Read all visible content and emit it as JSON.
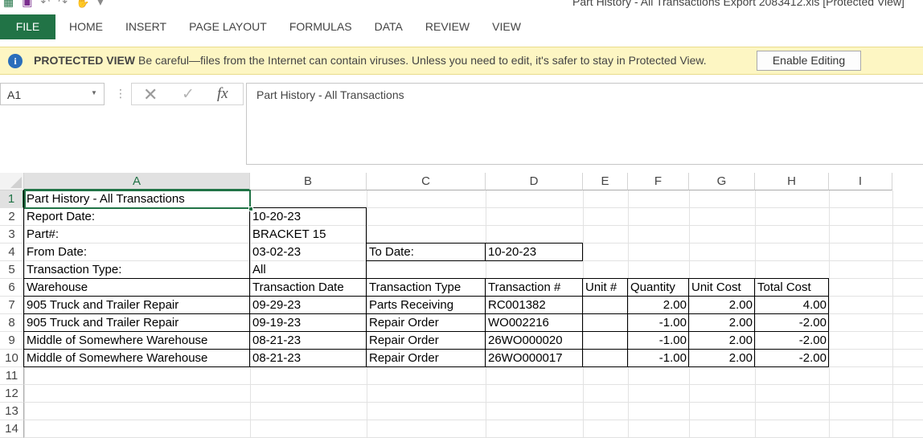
{
  "window": {
    "title": "Part History - All Transactions Export 2083412.xls  [Protected View]"
  },
  "quick_access": {
    "icons": [
      "excel-logo-icon",
      "save-icon",
      "undo-icon",
      "redo-icon",
      "touch-mode-icon",
      "customize-toolbar-icon"
    ]
  },
  "ribbon": {
    "tabs": [
      "FILE",
      "HOME",
      "INSERT",
      "PAGE LAYOUT",
      "FORMULAS",
      "DATA",
      "REVIEW",
      "VIEW"
    ]
  },
  "protected_view": {
    "heading": "PROTECTED VIEW",
    "message": "Be careful—files from the Internet can contain viruses. Unless you need to edit, it's safer to stay in Protected View.",
    "button": "Enable Editing",
    "icon": "i"
  },
  "formula_bar": {
    "name_box": "A1",
    "fx_label": "fx",
    "content": "Part History - All Transactions"
  },
  "sheet": {
    "columns": [
      "A",
      "B",
      "C",
      "D",
      "E",
      "F",
      "G",
      "H",
      "I"
    ],
    "rows": [
      "1",
      "2",
      "3",
      "4",
      "5",
      "6",
      "7",
      "8",
      "9",
      "10",
      "11",
      "12",
      "13",
      "14"
    ],
    "cells": {
      "A1": "Part History - All Transactions",
      "A2": "Report Date:",
      "B2": "10-20-23",
      "A3": "Part#:",
      "B3": "BRACKET 15",
      "A4": "From Date:",
      "B4": "03-02-23",
      "C4": "To Date:",
      "D4": "10-20-23",
      "A5": "Transaction Type:",
      "B5": "All",
      "A6": "Warehouse",
      "B6": "Transaction Date",
      "C6": "Transaction Type",
      "D6": "Transaction #",
      "E6": "Unit #",
      "F6": "Quantity",
      "G6": "Unit Cost",
      "H6": "Total Cost",
      "A7": "905 Truck and Trailer Repair",
      "B7": "09-29-23",
      "C7": "Parts Receiving",
      "D7": "RC001382",
      "F7": "2.00",
      "G7": "2.00",
      "H7": "4.00",
      "A8": "905 Truck and Trailer Repair",
      "B8": "09-19-23",
      "C8": "Repair Order",
      "D8": "WO002216",
      "F8": "-1.00",
      "G8": "2.00",
      "H8": "-2.00",
      "A9": "Middle of Somewhere Warehouse",
      "B9": "08-21-23",
      "C9": "Repair Order",
      "D9": "26WO000020",
      "F9": "-1.00",
      "G9": "2.00",
      "H9": "-2.00",
      "A10": "Middle of Somewhere Warehouse",
      "B10": "08-21-23",
      "C10": "Repair Order",
      "D10": "26WO000017",
      "F10": "-1.00",
      "G10": "2.00",
      "H10": "-2.00"
    },
    "selected_cell": "A1"
  },
  "colors": {
    "excel_green": "#217346",
    "protected_bar": "#fdf6c3",
    "info_blue": "#2a6ebb"
  }
}
